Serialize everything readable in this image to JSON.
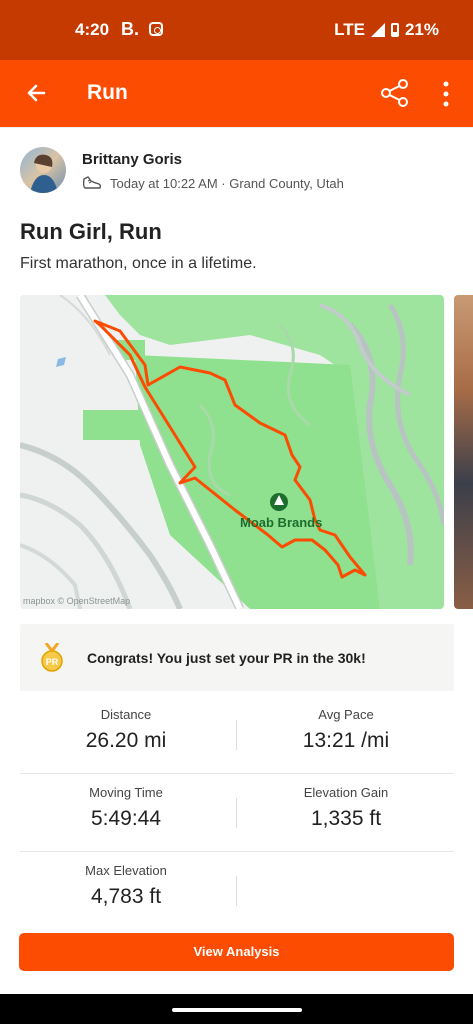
{
  "status_bar": {
    "time": "4:20",
    "carrier_icon": "B.",
    "network": "LTE",
    "battery": "21%"
  },
  "app_bar": {
    "title": "Run"
  },
  "activity": {
    "athlete_name": "Brittany Goris",
    "meta": "Today at 10:22 AM · Grand County, Utah",
    "title": "Run Girl, Run",
    "description": "First marathon, once in a lifetime."
  },
  "map": {
    "place_label": "Moab Brands",
    "attribution": "mapbox © OpenStreetMap"
  },
  "achievement": {
    "text": "Congrats! You just set your PR in the 30k!",
    "badge": "PR"
  },
  "stats": {
    "distance": {
      "label": "Distance",
      "value": "26.20 mi"
    },
    "avg_pace": {
      "label": "Avg Pace",
      "value": "13:21 /mi"
    },
    "moving_time": {
      "label": "Moving Time",
      "value": "5:49:44"
    },
    "elevation_gain": {
      "label": "Elevation Gain",
      "value": "1,335 ft"
    },
    "max_elevation": {
      "label": "Max Elevation",
      "value": "4,783 ft"
    }
  },
  "actions": {
    "view_analysis": "View Analysis"
  },
  "colors": {
    "brand": "#fc4c02",
    "status_bar": "#c43a00",
    "route": "#fc4c02",
    "park": "#8fe08f"
  }
}
